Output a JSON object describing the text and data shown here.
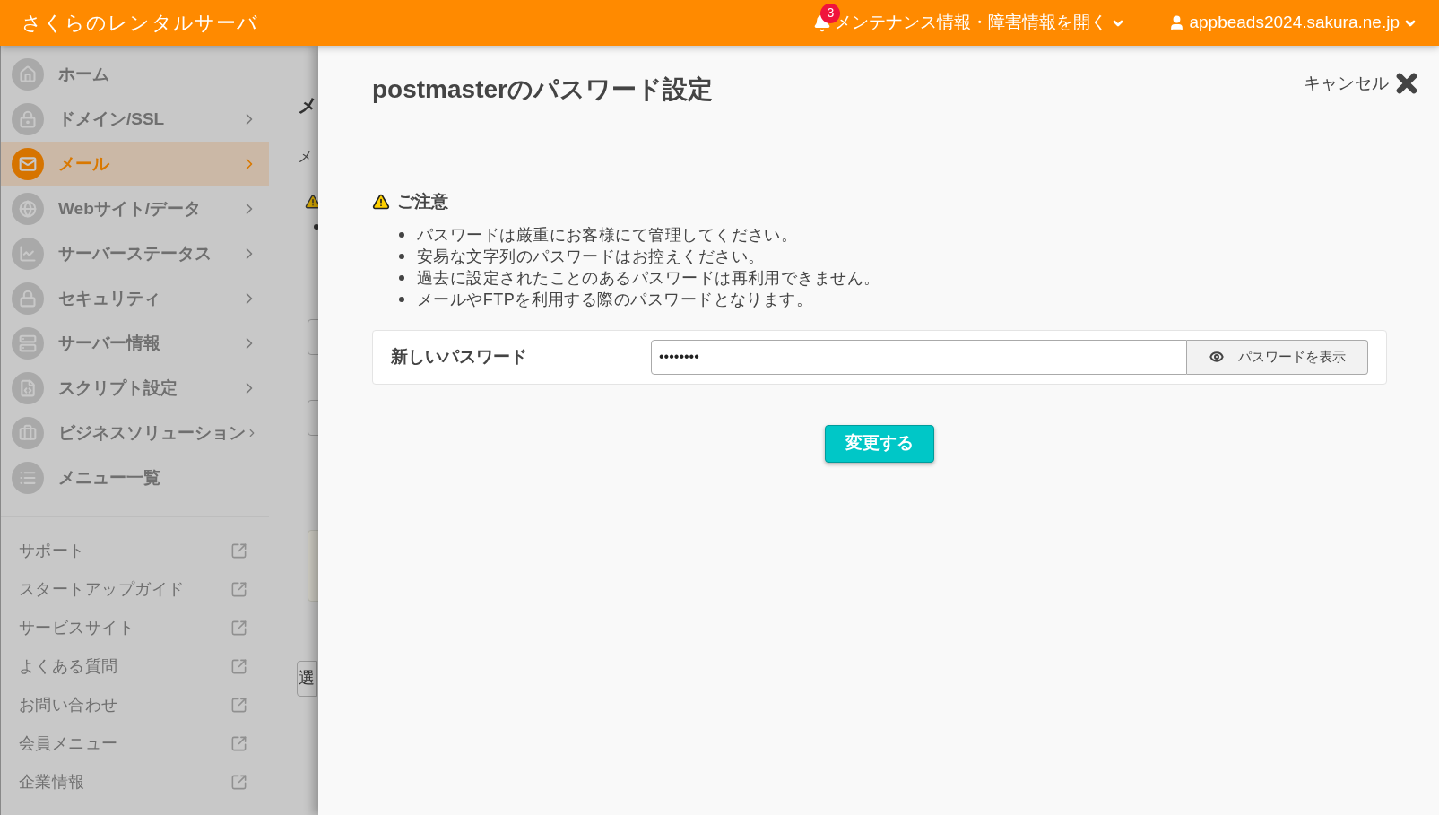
{
  "header": {
    "brand": "さくらのレンタルサーバ",
    "notifications": {
      "count": "3",
      "label": "メンテナンス情報・障害情報を開く"
    },
    "account": "appbeads2024.sakura.ne.jp"
  },
  "sidebar": {
    "items": [
      {
        "label": "ホーム",
        "selected": false,
        "expandable": false
      },
      {
        "label": "ドメイン/SSL",
        "selected": false,
        "expandable": true
      },
      {
        "label": "メール",
        "selected": true,
        "expandable": true
      },
      {
        "label": "Webサイト/データ",
        "selected": false,
        "expandable": true
      },
      {
        "label": "サーバーステータス",
        "selected": false,
        "expandable": true
      },
      {
        "label": "セキュリティ",
        "selected": false,
        "expandable": true
      },
      {
        "label": "サーバー情報",
        "selected": false,
        "expandable": true
      },
      {
        "label": "スクリプト設定",
        "selected": false,
        "expandable": true
      },
      {
        "label": "ビジネスソリューション",
        "selected": false,
        "expandable": true
      },
      {
        "label": "メニュー一覧",
        "selected": false,
        "expandable": false
      }
    ],
    "links": [
      "サポート",
      "スタートアップガイド",
      "サービスサイト",
      "よくある質問",
      "お問い合わせ",
      "会員メニュー",
      "企業情報"
    ]
  },
  "background": {
    "heading": "メ",
    "text": "メ",
    "button": "選"
  },
  "panel": {
    "title": "postmasterのパスワード設定",
    "cancel": "キャンセル",
    "notice": {
      "title": "ご注意",
      "items": [
        "パスワードは厳重にお客様にて管理してください。",
        "安易な文字列のパスワードはお控えください。",
        "過去に設定されたことのあるパスワードは再利用できません。",
        "メールやFTPを利用する際のパスワードとなります。"
      ]
    },
    "field": {
      "label": "新しいパスワード",
      "value": "••••••••",
      "toggle": "パスワードを表示"
    },
    "submit": "変更する"
  }
}
